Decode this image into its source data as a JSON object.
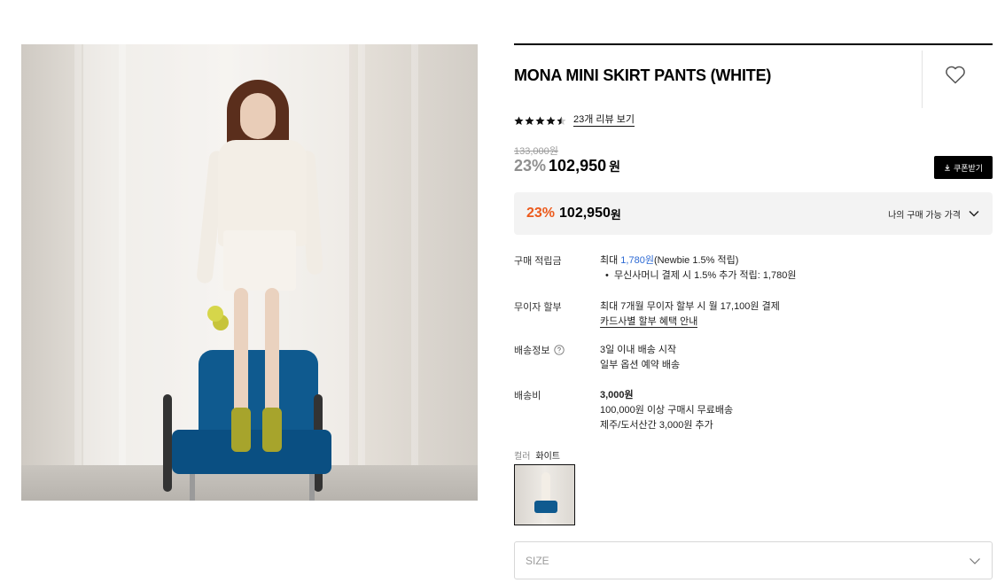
{
  "product": {
    "title": "MONA MINI SKIRT PANTS (WHITE)",
    "rating": 4.5,
    "review_link": "23개 리뷰 보기"
  },
  "price": {
    "original": "133,000원",
    "sale_rate": "23%",
    "sale_price": "102,950",
    "won": "원",
    "coupon_button": "쿠폰받기"
  },
  "my_price": {
    "rate": "23%",
    "price": "102,950",
    "won": "원",
    "label": "나의 구매 가능 가격"
  },
  "details": {
    "points": {
      "label": "구매 적립금",
      "prefix": "최대 ",
      "amount": "1,780원",
      "suffix": "(Newbie 1.5% 적립)",
      "bullet": "무신사머니 결제 시 1.5% 추가 적립: 1,780원"
    },
    "installment": {
      "label": "무이자 할부",
      "line1": "최대 7개월 무이자 할부 시 월 17,100원 결제",
      "link": "카드사별 할부 혜택 안내"
    },
    "shipping_info": {
      "label": "배송정보",
      "line1": "3일 이내 배송 시작",
      "line2": "일부 옵션 예약 배송"
    },
    "shipping_fee": {
      "label": "배송비",
      "amount": "3,000원",
      "line1": "100,000원 이상 구매시 무료배송",
      "line2": "제주/도서산간 3,000원 추가"
    }
  },
  "color": {
    "label": "컬러",
    "value": "화이트"
  },
  "size_select": {
    "placeholder": "SIZE"
  },
  "icons": {
    "wishlist": "heart-icon",
    "coupon": "download-icon",
    "expand": "chevron-down-icon",
    "help": "question-circle-icon"
  },
  "colors": {
    "accent_orange": "#ec5a1c",
    "link_blue": "#2d6ad4"
  }
}
